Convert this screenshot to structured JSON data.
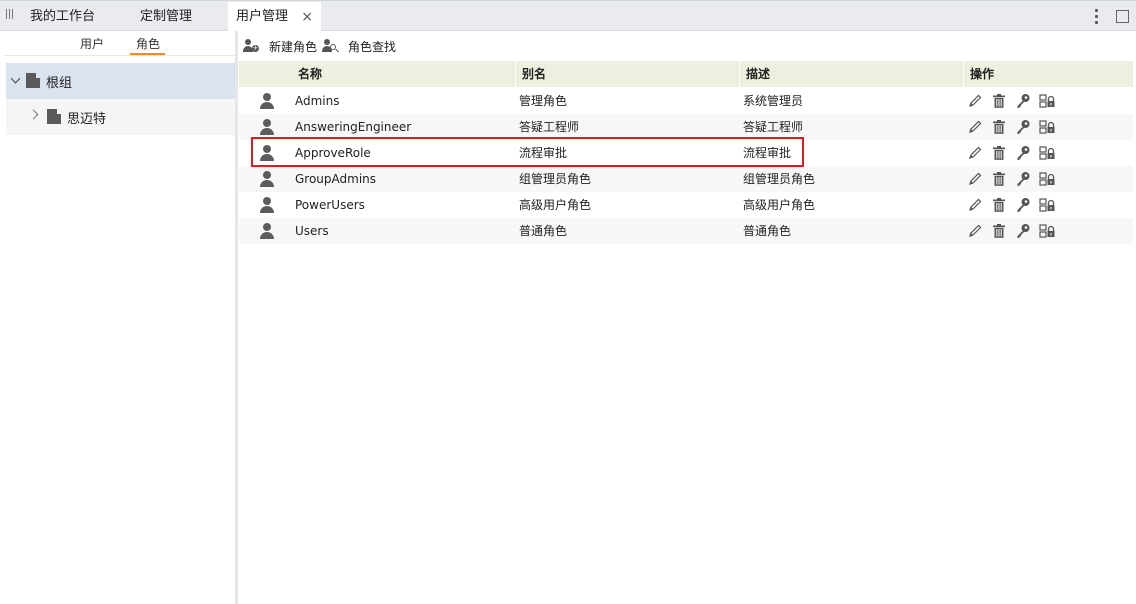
{
  "tabs": [
    {
      "label": "我的工作台"
    },
    {
      "label": "定制管理"
    },
    {
      "label": "用户管理",
      "close": "×"
    }
  ],
  "left_panel": {
    "subtabs": [
      {
        "label": "用户"
      },
      {
        "label": "角色"
      }
    ],
    "active_subtab": "角色",
    "tree": {
      "root": {
        "label": "根组",
        "icon": "building-icon",
        "expanded": true
      },
      "children": [
        {
          "label": "思迈特",
          "icon": "building-icon",
          "expanded": false
        }
      ]
    }
  },
  "toolbar": {
    "new_role": "新建角色",
    "search_role": "角色查找"
  },
  "table": {
    "headers": [
      "名称",
      "别名",
      "描述",
      "操作"
    ],
    "rows": [
      {
        "name": "Admins",
        "alias": "管理角色",
        "desc": "系统管理员"
      },
      {
        "name": "AnsweringEngineer",
        "alias": "答疑工程师",
        "desc": "答疑工程师"
      },
      {
        "name": "ApproveRole",
        "alias": "流程审批",
        "desc": "流程审批"
      },
      {
        "name": "GroupAdmins",
        "alias": "组管理员角色",
        "desc": "组管理员角色"
      },
      {
        "name": "PowerUsers",
        "alias": "高级用户角色",
        "desc": "高级用户角色"
      },
      {
        "name": "Users",
        "alias": "普通角色",
        "desc": "普通角色"
      }
    ],
    "row_actions": [
      "edit-icon",
      "delete-icon",
      "key-icon",
      "permission-lock-icon"
    ],
    "highlighted_row": "ApproveRole"
  },
  "colors": {
    "accent_underline": "#f08a24",
    "header_bg": "#efefdf",
    "tree_selected_bg": "#dbe3f0",
    "highlight_border": "#d81e1e"
  }
}
